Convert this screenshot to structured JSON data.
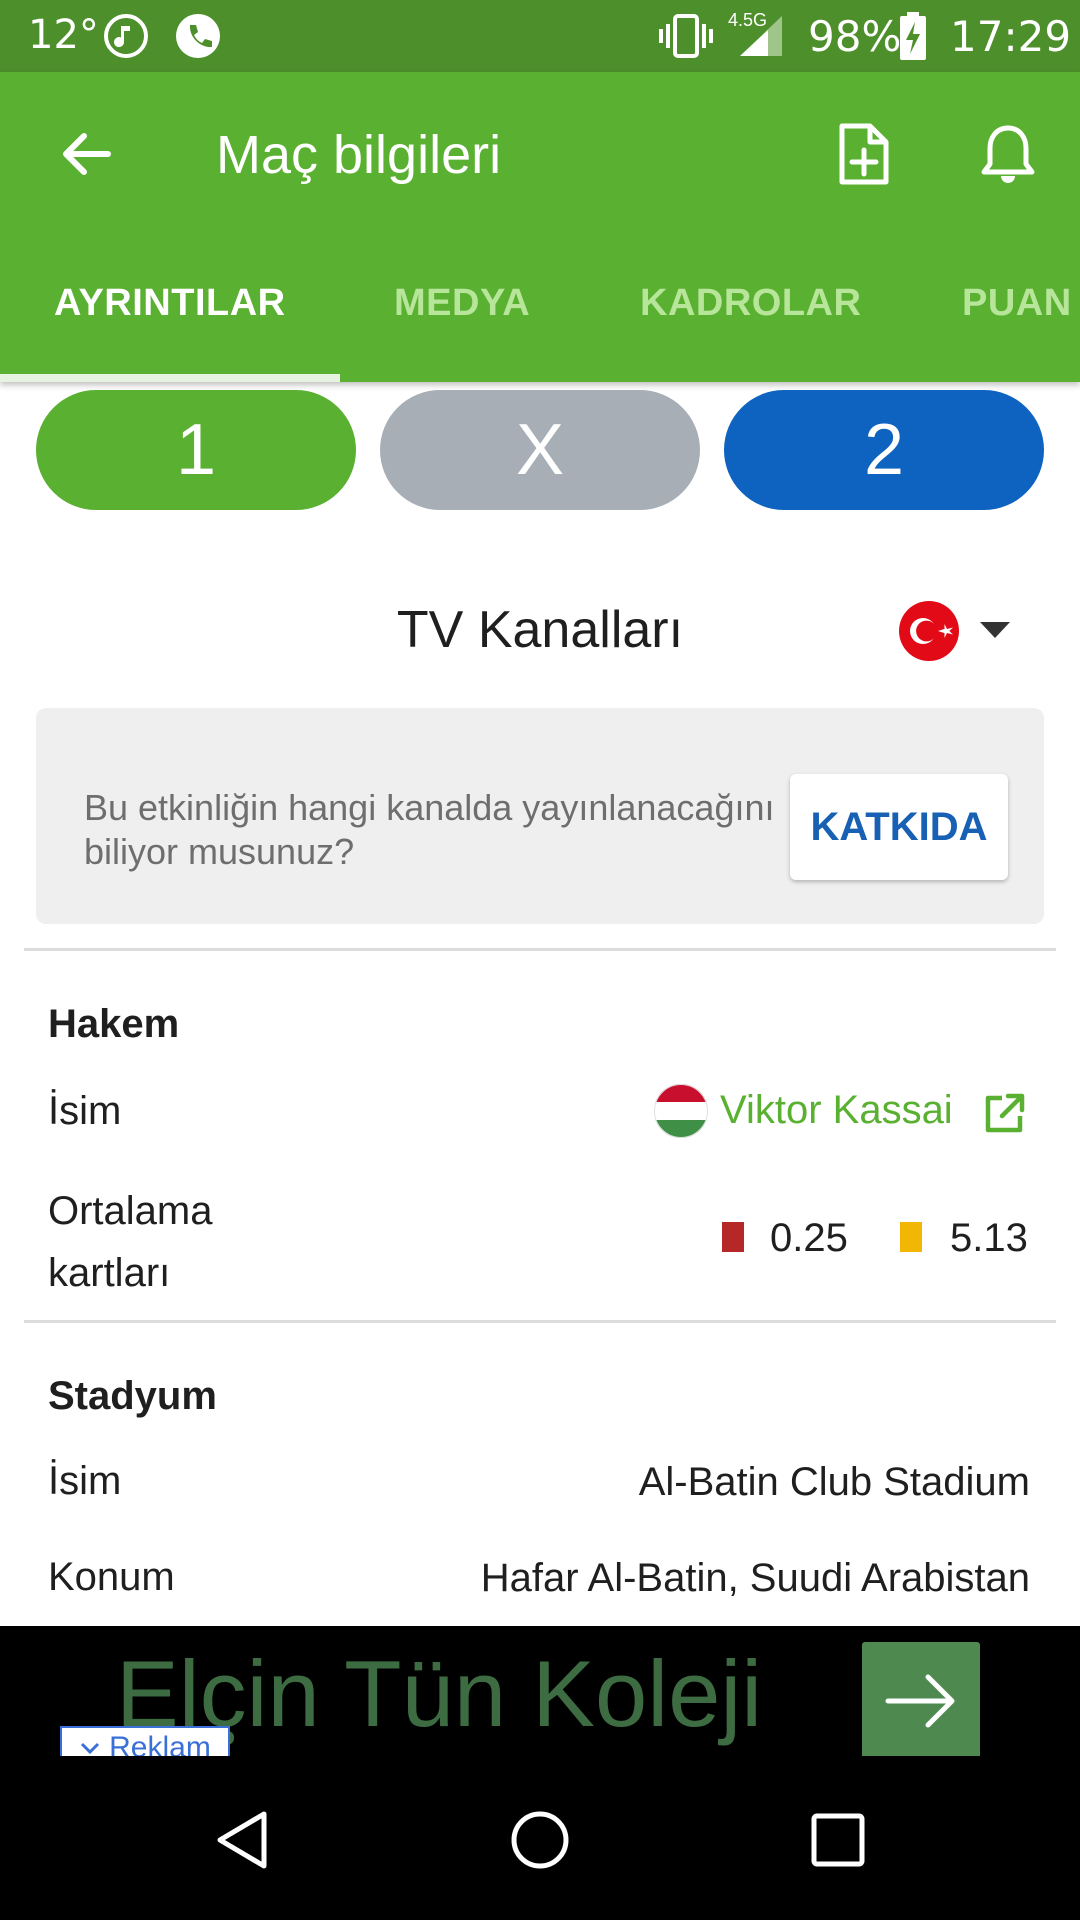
{
  "status_bar": {
    "temperature": "12°",
    "network": "4.5G",
    "battery": "98%",
    "time": "17:29"
  },
  "app_bar": {
    "title": "Maç bilgileri",
    "icons": [
      "back-arrow-icon",
      "add-document-icon",
      "bell-icon"
    ]
  },
  "tabs": [
    {
      "label": "AYRINTILAR",
      "active": true
    },
    {
      "label": "MEDYA",
      "active": false
    },
    {
      "label": "KADROLAR",
      "active": false
    },
    {
      "label": "PUAN",
      "active": false
    }
  ],
  "odds": [
    {
      "label": "1",
      "color": "#59b031"
    },
    {
      "label": "X",
      "color": "#a8aeb6"
    },
    {
      "label": "2",
      "color": "#0f63c0"
    }
  ],
  "tv": {
    "title": "TV Kanalları",
    "prompt": "Bu etkinliğin hangi kanalda yayınlanacağını biliyor musunuz?",
    "contribute_label": "KATKIDA"
  },
  "referee": {
    "section_title": "Hakem",
    "name_label": "İsim",
    "name_value": "Viktor Kassai",
    "cards_label": "Ortalama kartları",
    "red_cards": "0.25",
    "yellow_cards": "5.13"
  },
  "stadium": {
    "section_title": "Stadyum",
    "name_label": "İsim",
    "name_value": "Al-Batin Club Stadium",
    "location_label": "Konum",
    "location_value": "Hafar Al-Batin, Suudi Arabistan"
  },
  "ad": {
    "text": "Elçin Tün Koleji",
    "badge": "Reklam"
  },
  "colors": {
    "status_bar": "#4d8f2a",
    "app_bar": "#59b031",
    "link_green": "#59b031",
    "contribute_blue": "#1760b3",
    "red_card": "#b62828",
    "yellow_card": "#f2b705"
  }
}
